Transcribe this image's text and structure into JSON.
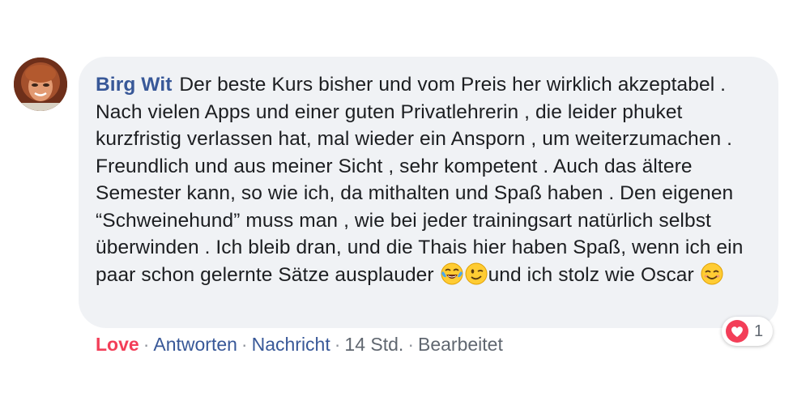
{
  "comment": {
    "author": "Birg Wit",
    "text_part1": " Der beste Kurs bisher und vom Preis her wirklich akzeptabel . Nach vielen Apps und einer guten Privatlehrerin , die leider phuket kurzfristig verlassen hat, mal wieder ein Ansporn , um weiterzumachen . Freundlich und aus meiner Sicht , sehr kompetent . Auch das ältere Semester kann, so wie ich, da mithalten und Spaß haben . Den eigenen “Schweinehund” muss man , wie bei jeder trainingsart natürlich selbst überwinden . Ich bleib dran, und die Thais hier haben Spaß, wenn ich ein paar schon gelernte Sätze ausplauder ",
    "text_part2": "und ich stolz wie Oscar ",
    "emojis": [
      "tears-of-joy-emoji",
      "winking-emoji",
      "smiling-eyes-emoji"
    ]
  },
  "actions": {
    "love": "Love",
    "reply": "Antworten",
    "message": "Nachricht",
    "time": "14 Std.",
    "edited": "Bearbeitet",
    "separator": "·"
  },
  "reaction": {
    "icon": "heart-icon",
    "count": "1"
  },
  "colors": {
    "author": "#385898",
    "love": "#f33e58",
    "bubble": "#f0f2f5",
    "text": "#1c1e21",
    "meta": "#606770"
  }
}
